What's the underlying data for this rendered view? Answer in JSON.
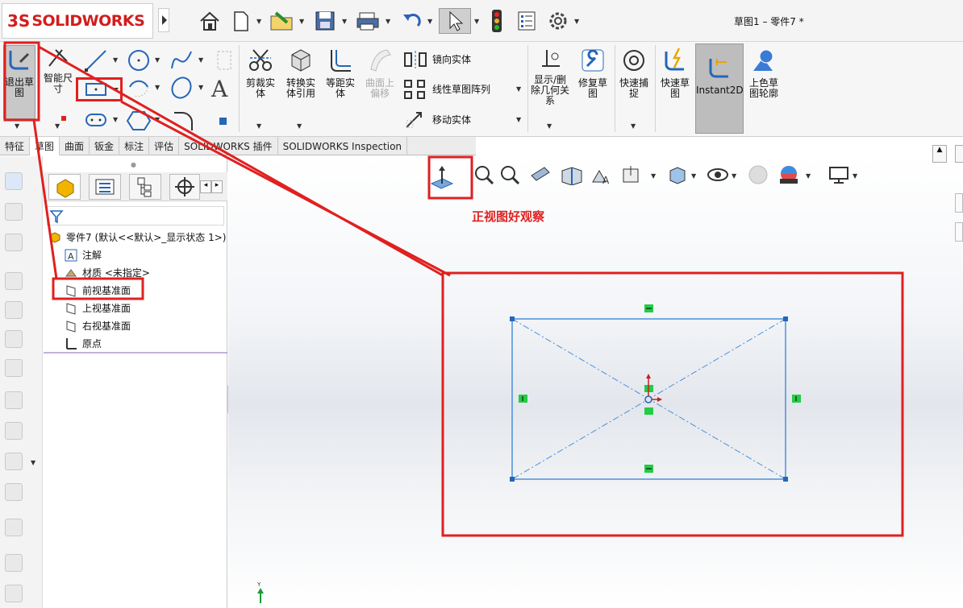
{
  "app": {
    "logo_text": "SOLIDWORKS",
    "logo_mark": "3S",
    "doc_title": "草图1 – 零件7 *"
  },
  "ribbon": {
    "exit_sketch": "退出草图",
    "smart_dim": "智能尺寸",
    "trim": "剪裁实体",
    "convert": "转换实体引用",
    "offset": "等距实体",
    "surface_offset": "曲面上偏移",
    "mirror": "镜向实体",
    "linear_pattern": "线性草图阵列",
    "move": "移动实体",
    "display_relations": "显示/删除几何关系",
    "repair": "修复草图",
    "quick_snap": "快速捕捉",
    "rapid_sketch": "快速草图",
    "instant2d": "Instant2D",
    "shaded_contour": "上色草图轮廓"
  },
  "tabs": [
    "特征",
    "草图",
    "曲面",
    "钣金",
    "标注",
    "评估",
    "SOLIDWORKS 插件",
    "SOLIDWORKS Inspection"
  ],
  "active_tab_index": 1,
  "tree": {
    "root": "零件7 (默认<<默认>_显示状态 1>)",
    "items": [
      "注解",
      "材质 <未指定>",
      "前视基准面",
      "上视基准面",
      "右视基准面",
      "原点"
    ]
  },
  "annotation": {
    "note": "正视图好观察"
  },
  "axis_label": "Y",
  "colors": {
    "annotation_red": "#e02020",
    "sketch_blue": "#4a90d9",
    "relation_green": "#22cc44"
  }
}
